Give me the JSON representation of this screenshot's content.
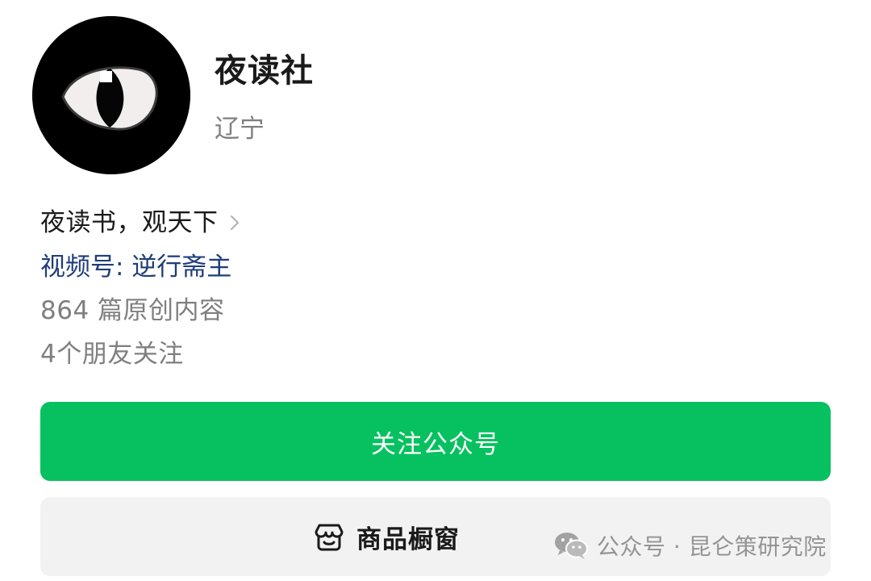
{
  "profile": {
    "avatar_icon": "cat-eye-avatar",
    "name": "夜读社",
    "location": "辽宁",
    "bio": "夜读书，观天下",
    "bio_chevron_icon": "chevron-right-icon",
    "channels_link": "视频号: 逆行斋主",
    "articles_count": "864 篇原创内容",
    "friends_following": "4个朋友关注"
  },
  "actions": {
    "follow_label": "关注公众号",
    "shop_label": "商品橱窗",
    "shop_icon": "storefront-icon"
  },
  "watermark": {
    "icon": "wechat-icon",
    "text": "公众号 · 昆仑策研究院"
  },
  "colors": {
    "primary_green": "#07c160",
    "link_blue": "#1f3d78",
    "secondary_text": "#7f7f7f",
    "shop_bg": "#f2f2f2"
  }
}
